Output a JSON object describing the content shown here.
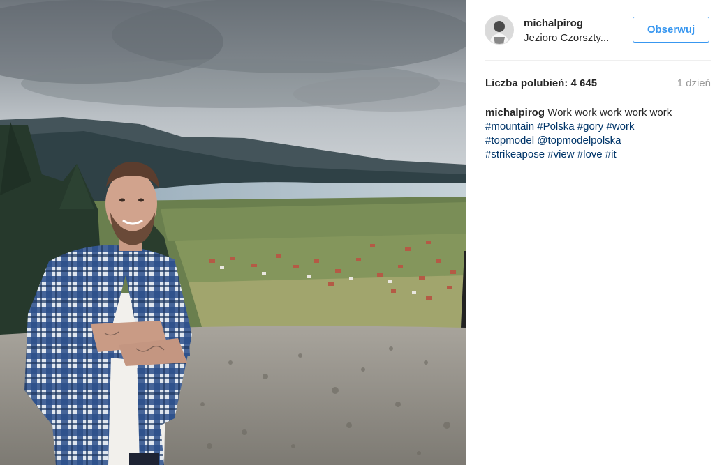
{
  "post": {
    "image_alt": "Man in blue plaid shirt with crossed arms standing on a rocky hillside above a lake and village",
    "author": {
      "username": "michalpirog",
      "location": "Jezioro Czorszty..."
    },
    "follow_label": "Obserwuj",
    "likes_label": "Liczba polubień: 4 645",
    "time_ago": "1 dzień",
    "caption": {
      "username": "michalpirog",
      "text": "Work work work work work",
      "hashtags": [
        "#mountain",
        "#Polska",
        "#gory",
        "#work",
        "#topmodel",
        "@topmodelpolska",
        "#strikeapose",
        "#view",
        "#love",
        "#it"
      ]
    }
  },
  "colors": {
    "accent": "#3897f0",
    "link": "#003569",
    "muted": "#999999",
    "text": "#262626"
  }
}
